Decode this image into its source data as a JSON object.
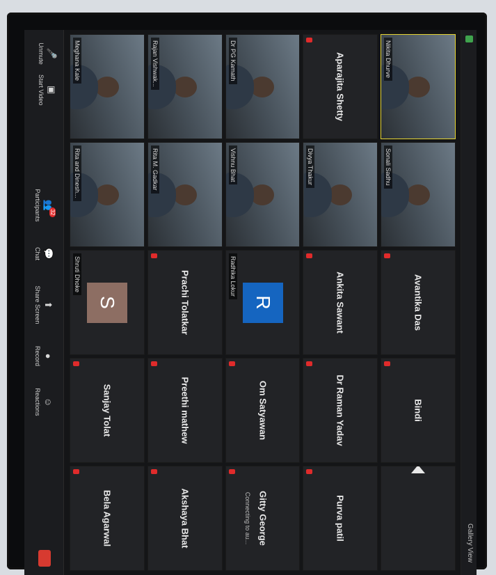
{
  "topbar": {
    "view_label": "Gallery View"
  },
  "participants": [
    {
      "name": "Nikita Dhurve",
      "type": "video",
      "active": true
    },
    {
      "name": "Sonali Sadhu",
      "type": "video"
    },
    {
      "name": "Avantika Das",
      "type": "name"
    },
    {
      "name": "Bindi",
      "type": "name"
    },
    {
      "name": "",
      "type": "empty"
    },
    {
      "name": "Aparajita Shetty",
      "type": "name"
    },
    {
      "name": "Divya Thakur",
      "type": "video"
    },
    {
      "name": "Ankita Sawant",
      "type": "name"
    },
    {
      "name": "Dr Raman Yadav",
      "type": "name"
    },
    {
      "name": "Purva patil",
      "type": "name"
    },
    {
      "name": "Dr PG Kamath",
      "type": "video"
    },
    {
      "name": "Vishnu Bhat",
      "type": "video"
    },
    {
      "name": "Radhika Lokur",
      "type": "avatar",
      "letter": "R",
      "color": "#1565c0"
    },
    {
      "name": "Om Satyawan",
      "type": "name"
    },
    {
      "name": "Gitty George",
      "type": "name",
      "sub": "Connecting to au..."
    },
    {
      "name": "Rajan Vishwak...",
      "type": "video"
    },
    {
      "name": "Rita M. Gadkar",
      "type": "video"
    },
    {
      "name": "Prachi Tolatkar",
      "type": "name"
    },
    {
      "name": "Preethi mathew",
      "type": "name"
    },
    {
      "name": "Akshaya Bhat",
      "type": "name"
    },
    {
      "name": "Meghana Kale",
      "type": "video"
    },
    {
      "name": "Rita and Dinesh...",
      "type": "video"
    },
    {
      "name": "Shruti Dhoke",
      "type": "avatar",
      "letter": "S",
      "color": "#8d6e63"
    },
    {
      "name": "Sanjay Tolat",
      "type": "name"
    },
    {
      "name": "Bela Agarwal",
      "type": "name"
    }
  ],
  "toolbar": {
    "unmute": "Unmute",
    "start_video": "Start Video",
    "participants": "Participants",
    "participants_count": "32",
    "chat": "Chat",
    "share_screen": "Share Screen",
    "record": "Record",
    "reactions": "Reactions"
  }
}
